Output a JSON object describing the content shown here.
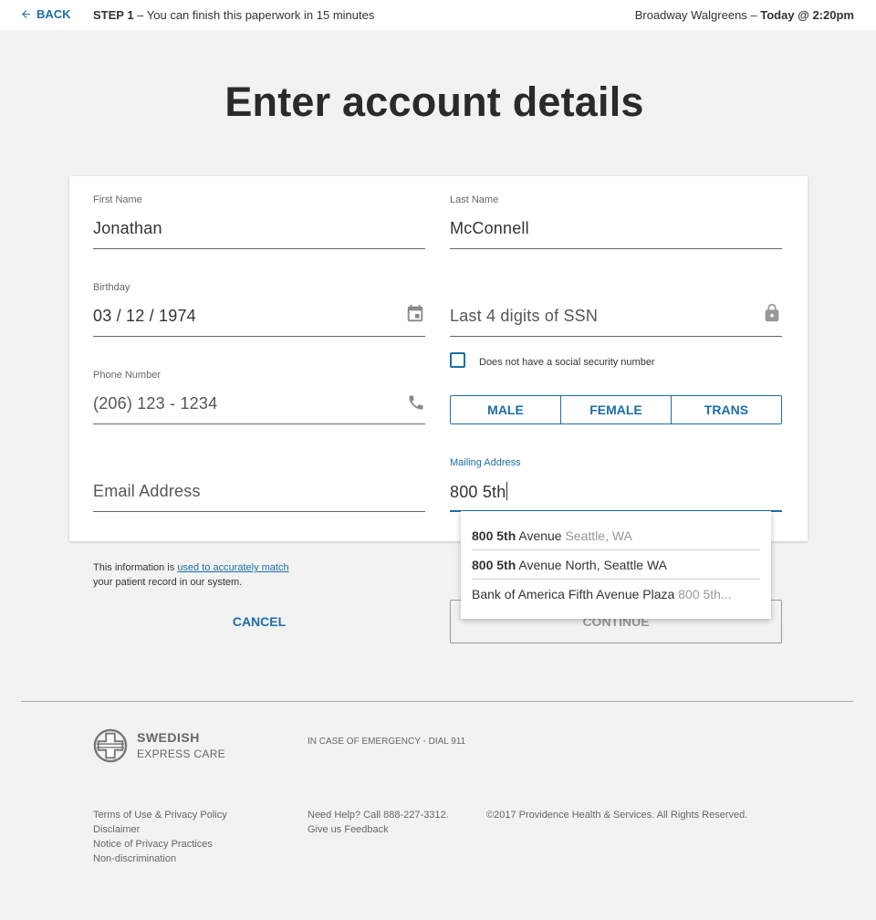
{
  "topbar": {
    "back_label": "BACK",
    "step_label": "STEP 1",
    "step_text": " – You can finish this paperwork in 15 minutes",
    "location": "Broadway Walgreens – ",
    "appointment": "Today @ 2:20pm"
  },
  "page": {
    "title": "Enter account details"
  },
  "form": {
    "first_name": {
      "label": "First Name",
      "value": "Jonathan"
    },
    "last_name": {
      "label": "Last Name",
      "value": "McConnell"
    },
    "birthday": {
      "label": "Birthday",
      "value": "03 / 12 / 1974"
    },
    "ssn": {
      "placeholder": "Last 4 digits of SSN"
    },
    "ssn_checkbox_label": "Does not have a social security number",
    "phone": {
      "label": "Phone Number",
      "placeholder": "(206) 123 - 1234"
    },
    "gender_options": [
      "MALE",
      "FEMALE",
      "TRANS"
    ],
    "email": {
      "placeholder": "Email Address"
    },
    "mailing": {
      "label": "Mailing Address",
      "value": "800 5th"
    }
  },
  "autocomplete": [
    {
      "bold": "800 5th",
      "text": " Avenue",
      "dim": " Seattle, WA"
    },
    {
      "bold": "800 5th",
      "text": " Avenue North, Seattle WA",
      "dim": ""
    },
    {
      "bold": "",
      "text": "Bank of America Fifth Avenue Plaza",
      "dim": " 800 5th..."
    }
  ],
  "info": {
    "prefix": "This information is ",
    "link": "used to accurately match",
    "suffix": "your patient record in our system."
  },
  "actions": {
    "cancel": "CANCEL",
    "continue": "CONTINUE"
  },
  "footer": {
    "logo_line1": "SWEDISH",
    "logo_line2": "EXPRESS CARE",
    "emergency": "IN CASE OF EMERGENCY - DIAL 911",
    "links": [
      "Terms of Use & Privacy Policy",
      "Disclaimer",
      "Notice of Privacy Practices",
      "Non-discrimination"
    ],
    "help": "Need Help? Call 888-227-3312.",
    "feedback": "Give us Feedback",
    "copyright": "©2017 Providence Health & Services. All Rights Reserved."
  },
  "colors": {
    "accent": "#1b6fa8",
    "background": "#f2f2f2",
    "text": "#333333"
  }
}
